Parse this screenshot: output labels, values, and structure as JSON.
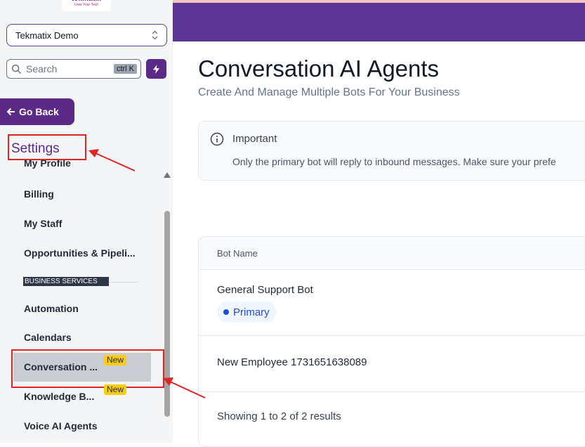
{
  "sidebar": {
    "logo": {
      "name": "tekmatix",
      "tagline": "Love Your Tech"
    },
    "account": {
      "name": "Tekmatix Demo"
    },
    "search": {
      "placeholder": "Search",
      "shortcut": "ctrl K"
    },
    "go_back": "Go Back",
    "heading": "Settings",
    "items": [
      {
        "label": "My Profile"
      },
      {
        "label": "Billing"
      },
      {
        "label": "My Staff"
      },
      {
        "label": "Opportunities & Pipeli..."
      },
      {
        "label": "Automation"
      },
      {
        "label": "Calendars"
      },
      {
        "label": "Conversation ...",
        "badge": "New",
        "active": true
      },
      {
        "label": "Knowledge B...",
        "badge": "New"
      },
      {
        "label": "Voice AI Agents"
      }
    ],
    "section_label": "BUSINESS SERVICES"
  },
  "main": {
    "title": "Conversation AI Agents",
    "subtitle": "Create And Manage Multiple Bots For Your Business",
    "notice": {
      "title": "Important",
      "body": "Only the primary bot will reply to inbound messages. Make sure your prefe"
    },
    "table": {
      "column_header": "Bot Name",
      "rows": [
        {
          "name": "General Support Bot",
          "tag": "Primary"
        },
        {
          "name": "New Employee 1731651638089"
        }
      ],
      "footer": "Showing 1 to 2 of 2 results"
    }
  },
  "colors": {
    "brand": "#5b2a86",
    "topbar": "#5b3594",
    "badge": "#facc15",
    "annotation": "#e02424",
    "primary_tag": "#1d4ed8"
  },
  "icons": [
    "updown-chevron-icon",
    "search-icon",
    "bolt-icon",
    "arrow-left-icon",
    "info-icon",
    "scroll-up-icon"
  ]
}
